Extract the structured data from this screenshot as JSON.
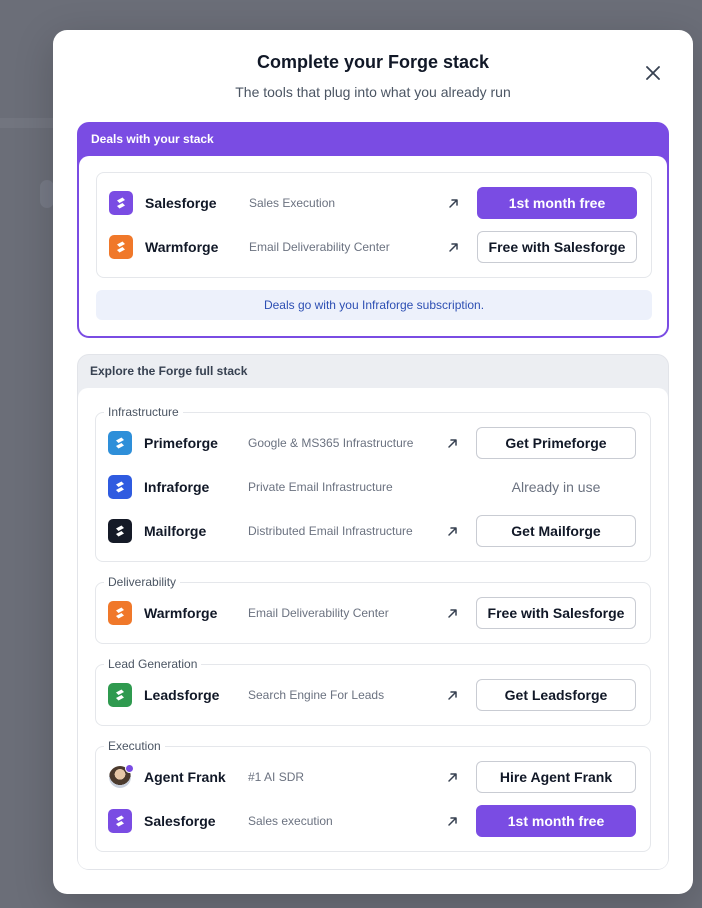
{
  "modal": {
    "title": "Complete your Forge stack",
    "subtitle": "The tools that plug into what you already run"
  },
  "colors": {
    "accent": "#7a4ce3",
    "overlay": "#6b6e78",
    "note_bg": "#edf1fb",
    "note_text": "#2d4fb3"
  },
  "deals": {
    "header": "Deals with your stack",
    "items": [
      {
        "name": "Salesforge",
        "description": "Sales Execution",
        "button": "1st month free",
        "logo_color": "#7a4ce3"
      },
      {
        "name": "Warmforge",
        "description": "Email Deliverability Center",
        "button": "Free with Salesforge",
        "logo_color": "#f0782a"
      }
    ],
    "note": "Deals go with you Infraforge subscription."
  },
  "explore": {
    "header": "Explore the Forge full stack",
    "groups": {
      "infrastructure": {
        "label": "Infrastructure",
        "items": [
          {
            "name": "Primeforge",
            "description": "Google & MS365 Infrastructure",
            "button": "Get Primeforge",
            "logo_color": "#2e8fd9"
          },
          {
            "name": "Infraforge",
            "description": "Private Email Infrastructure",
            "button": "Already in use",
            "logo_color": "#2f5be0"
          },
          {
            "name": "Mailforge",
            "description": "Distributed Email Infrastructure",
            "button": "Get Mailforge",
            "logo_color": "#151a27"
          }
        ]
      },
      "deliverability": {
        "label": "Deliverability",
        "items": [
          {
            "name": "Warmforge",
            "description": "Email Deliverability Center",
            "button": "Free with Salesforge",
            "logo_color": "#f0782a"
          }
        ]
      },
      "lead_generation": {
        "label": "Lead Generation",
        "items": [
          {
            "name": "Leadsforge",
            "description": "Search Engine For Leads",
            "button": "Get Leadsforge",
            "logo_color": "#2f9a4f"
          }
        ]
      },
      "execution": {
        "label": "Execution",
        "items": [
          {
            "name": "Agent Frank",
            "description": "#1 AI SDR",
            "button": "Hire Agent Frank",
            "logo": "avatar"
          },
          {
            "name": "Salesforge",
            "description": "Sales execution",
            "button": "1st month free",
            "logo_color": "#7a4ce3"
          }
        ]
      }
    }
  },
  "icons": {
    "close": "close-icon",
    "external": "arrow-up-right-icon",
    "product": "forge-logo-icon"
  }
}
